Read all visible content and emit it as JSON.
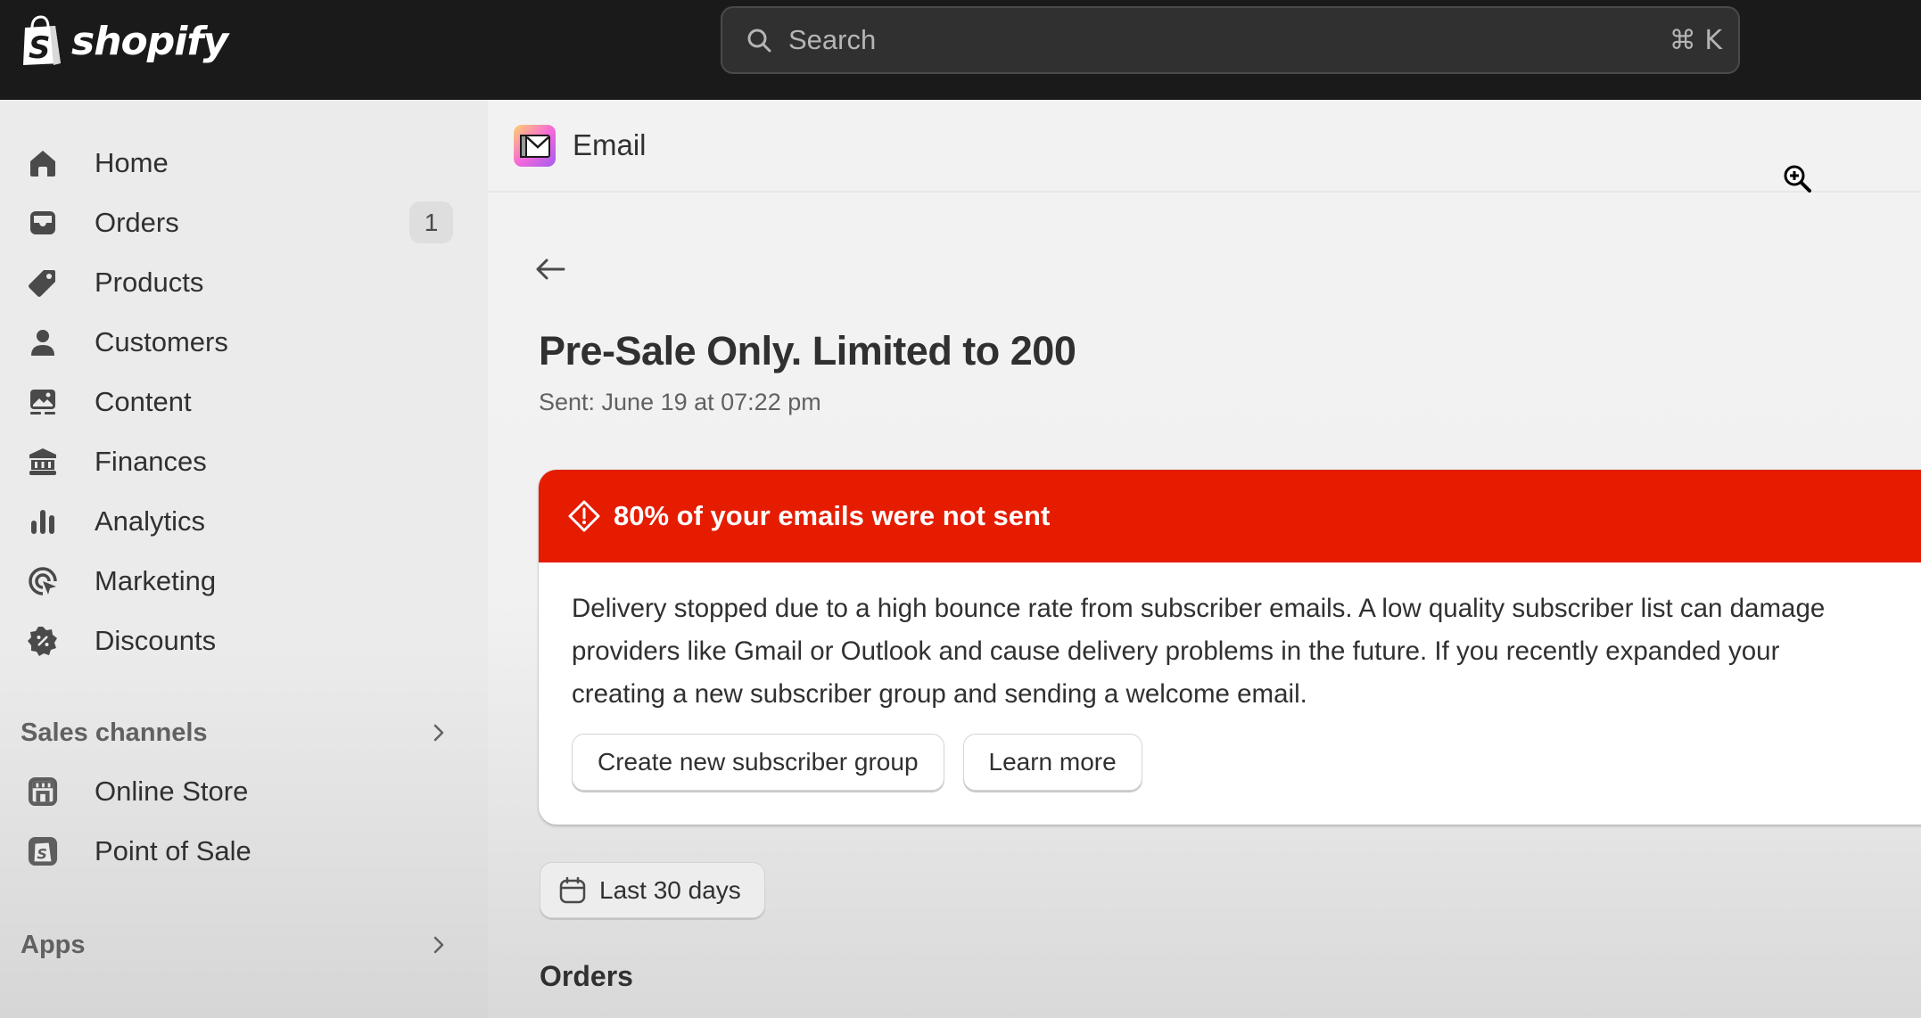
{
  "topbar": {
    "brand": "shopify",
    "search": {
      "placeholder": "Search",
      "value": "",
      "shortcut": "⌘ K"
    }
  },
  "sidebar": {
    "items": [
      {
        "label": "Home",
        "icon": "home-icon"
      },
      {
        "label": "Orders",
        "icon": "inbox-icon",
        "badge": "1"
      },
      {
        "label": "Products",
        "icon": "tag-icon"
      },
      {
        "label": "Customers",
        "icon": "person-icon"
      },
      {
        "label": "Content",
        "icon": "image-icon"
      },
      {
        "label": "Finances",
        "icon": "bank-icon"
      },
      {
        "label": "Analytics",
        "icon": "bar-chart-icon"
      },
      {
        "label": "Marketing",
        "icon": "target-icon"
      },
      {
        "label": "Discounts",
        "icon": "discount-icon"
      }
    ],
    "sales_channels": {
      "label": "Sales channels",
      "items": [
        {
          "label": "Online Store",
          "icon": "store-icon"
        },
        {
          "label": "Point of Sale",
          "icon": "pos-icon"
        }
      ]
    },
    "apps": {
      "label": "Apps"
    }
  },
  "main": {
    "app_title": "Email",
    "page_title": "Pre-Sale Only. Limited to 200",
    "sent": "Sent: June 19 at 07:22 pm",
    "banner": {
      "title": "80% of your emails were not sent",
      "color": "#e51c00",
      "lines": [
        "Delivery stopped due to a high bounce rate from subscriber emails. A low quality subscriber list can damage",
        "providers like Gmail or Outlook and cause delivery problems in the future. If you recently expanded your",
        "creating a new subscriber group and sending a welcome email."
      ],
      "primary_action": "Create new subscriber group",
      "secondary_action": "Learn more"
    },
    "date_range": "Last 30 days",
    "orders_heading": "Orders"
  }
}
